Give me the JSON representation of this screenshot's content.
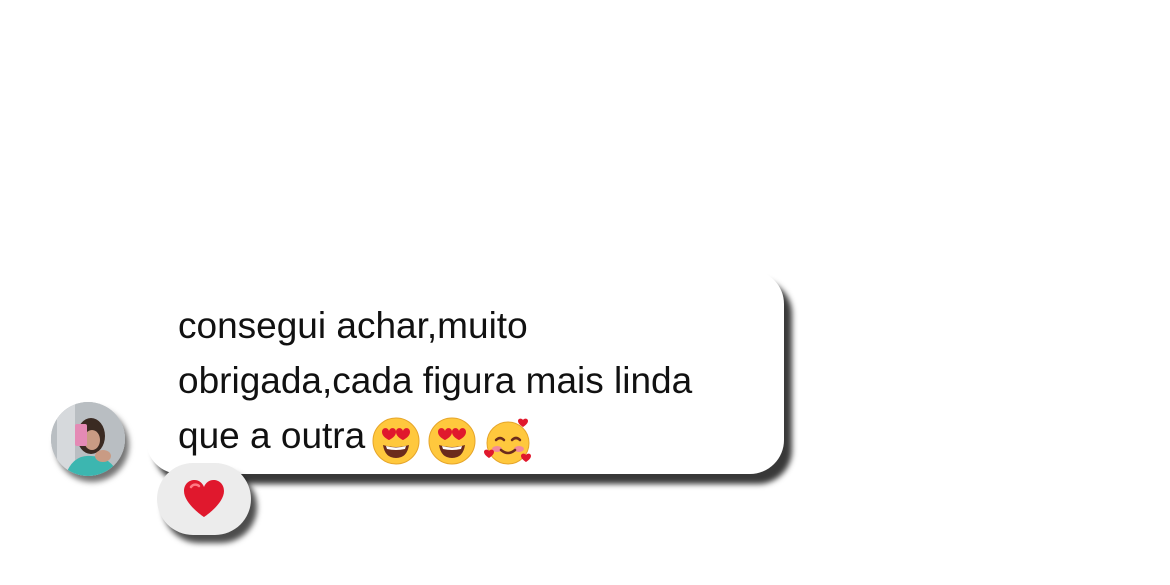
{
  "message": {
    "text_lines": [
      "consegui achar,muito",
      "obrigada,cada figura mais linda",
      "que a outra"
    ],
    "emojis": [
      "heart-eyes-emoji",
      "heart-eyes-emoji",
      "smiling-face-with-hearts-emoji"
    ]
  },
  "reaction": {
    "emoji": "red-heart-emoji"
  },
  "colors": {
    "bubble": "#ffffff",
    "text": "#111111",
    "reaction_pill": "#ececec",
    "heart": "#e0182d",
    "emoji_face": "#ffc83d"
  }
}
